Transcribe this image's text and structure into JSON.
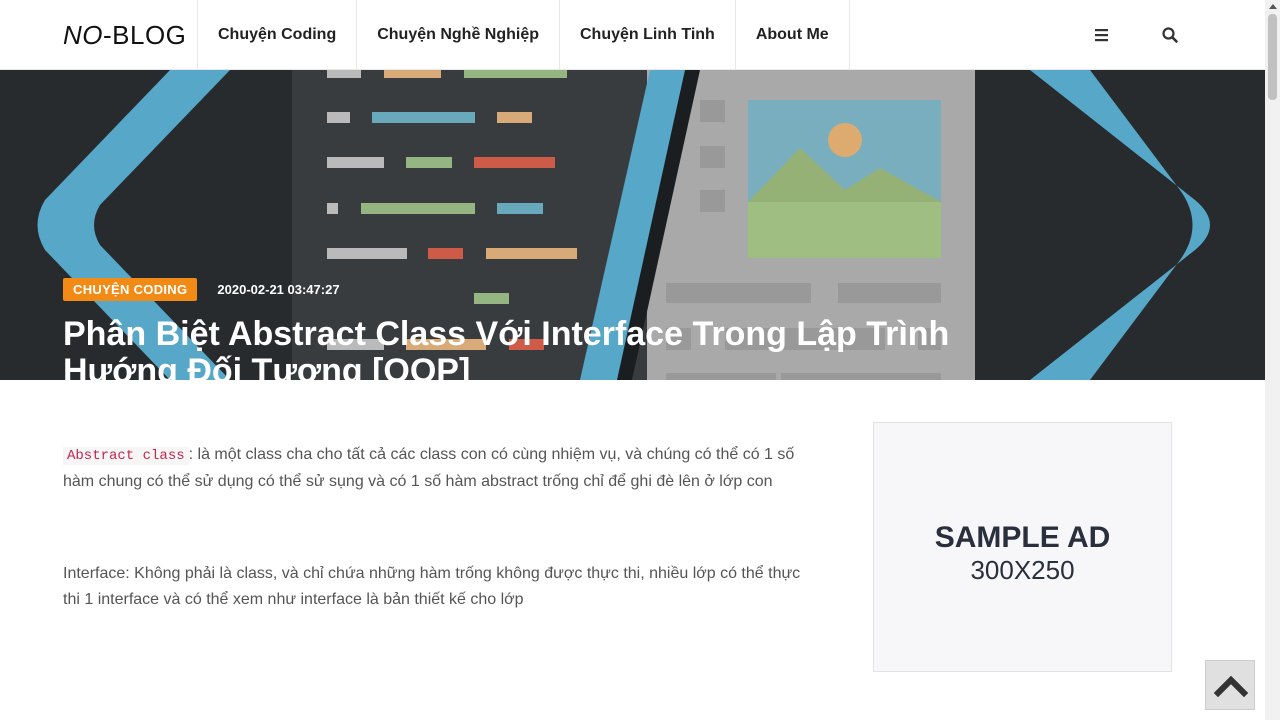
{
  "header": {
    "logo_part1": "NO",
    "logo_part2": "-BLOG",
    "nav": [
      {
        "label": "Chuyện Coding"
      },
      {
        "label": "Chuyện Nghề Nghiệp"
      },
      {
        "label": "Chuyện Linh Tinh"
      },
      {
        "label": "About Me"
      }
    ],
    "icons": {
      "menu": "hamburger-icon",
      "search": "search-icon"
    }
  },
  "hero": {
    "category": "CHUYỆN CODING",
    "date": "2020-02-21 03:47:27",
    "title": "Phân Biệt Abstract Class Với Interface Trong Lập Trình Hướng Đối Tượng [OOP]"
  },
  "article": {
    "p1_code": "Abstract class",
    "p1_text": ": là một class cha cho tất cả các class con có cùng nhiệm vụ, và chúng có thể có 1 số hàm chung có thể sử dụng  có thể sử sụng và có 1 số hàm abstract trống chỉ để ghi đè lên ở lớp con",
    "p2_text": "Interface: Không phải là class, và chỉ chứa những hàm trống không được thực thi, nhiều lớp có thể thực thi 1 interface và có thể xem như interface là bản thiết kế cho lớp"
  },
  "ad": {
    "title": "SAMPLE AD",
    "size": "300X250"
  },
  "colors": {
    "accent": "#f28a16",
    "heading": "#2a2f3d"
  }
}
